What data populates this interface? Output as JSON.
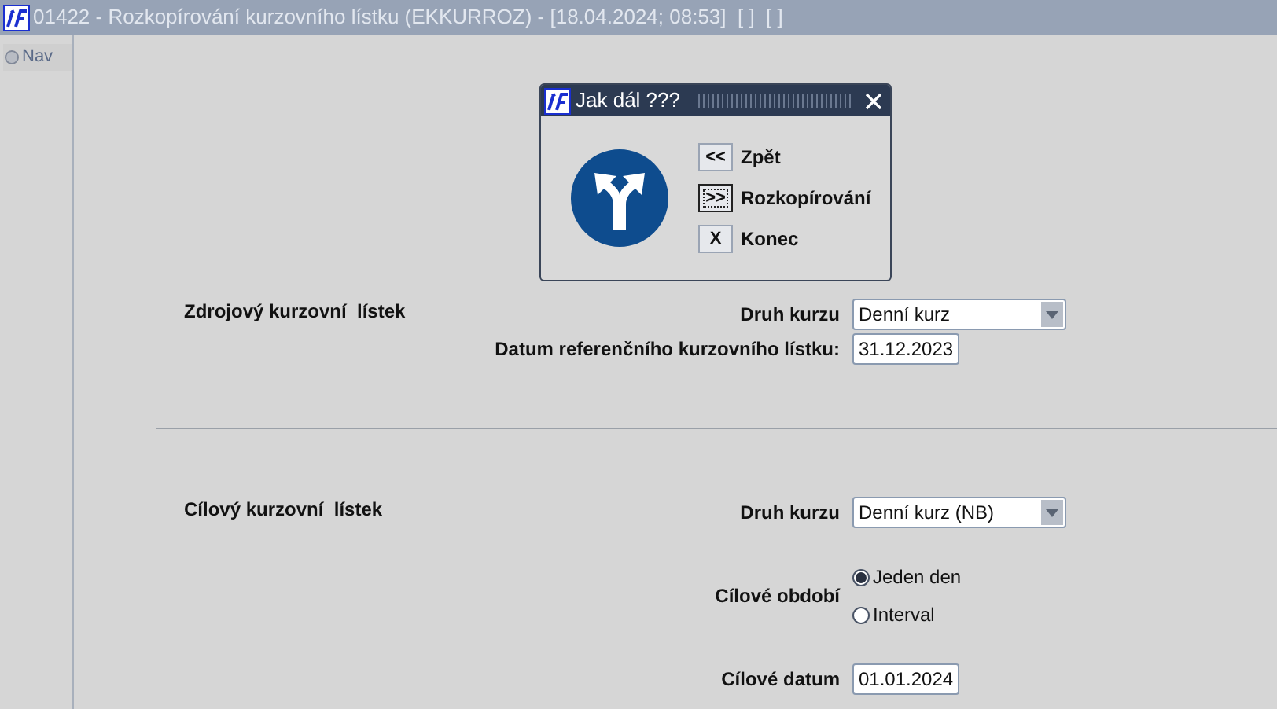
{
  "window": {
    "title": "01422 - Rozkopírování kurzovního lístku (EKKURROZ) - [18.04.2024; 08:53]  [ ]  [ ]"
  },
  "sidebar": {
    "items": [
      {
        "label": "Nav",
        "selected": false
      }
    ]
  },
  "dialog": {
    "title": "Jak dál ???",
    "buttons": [
      {
        "key": "<<",
        "label": "Zpět",
        "focused": false
      },
      {
        "key": ">>",
        "label": "Rozkopírování",
        "focused": true
      },
      {
        "key": "X",
        "label": "Konec",
        "focused": false
      }
    ]
  },
  "sections": [
    {
      "title": "Zdrojový kurzovní  lístek",
      "fields": [
        {
          "kind": "select",
          "label": "Druh kurzu",
          "value": "Denní kurz"
        },
        {
          "kind": "date",
          "label": "Datum referenčního kurzovního lístku:",
          "value": "31.12.2023"
        }
      ]
    },
    {
      "title": "Cílový kurzovní  lístek",
      "fields": [
        {
          "kind": "select",
          "label": "Druh kurzu",
          "value": "Denní kurz (NB)"
        },
        {
          "kind": "radio",
          "label": "Cílové období",
          "options": [
            {
              "label": "Jeden den",
              "selected": true
            },
            {
              "label": "Interval",
              "selected": false
            }
          ]
        },
        {
          "kind": "date",
          "label": "Cílové datum",
          "value": "01.01.2024"
        }
      ]
    }
  ]
}
